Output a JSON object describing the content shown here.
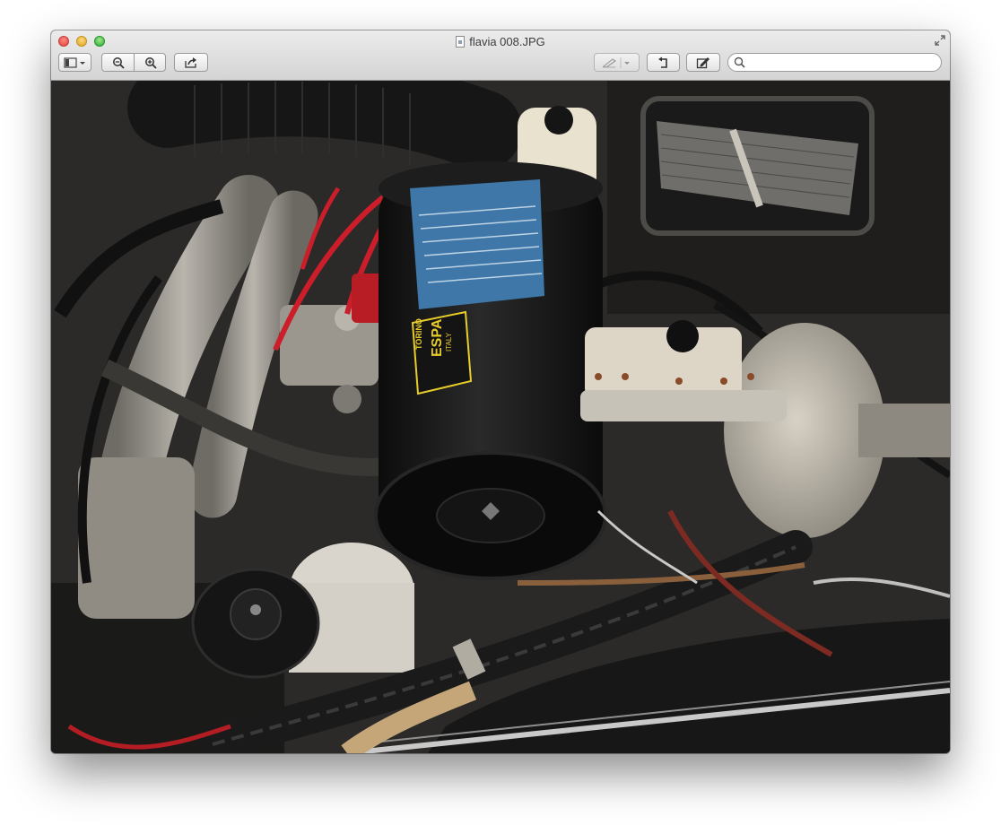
{
  "window": {
    "title": "flavia 008.JPG",
    "icons": [
      "close-button",
      "minimize-button",
      "zoom-button",
      "document-icon",
      "fullscreen-icon"
    ]
  },
  "toolbar": {
    "buttons": [
      {
        "name": "view-mode-button",
        "icon": "sidebar-icon"
      },
      {
        "name": "zoom-out-button",
        "icon": "zoom-out-icon"
      },
      {
        "name": "zoom-in-button",
        "icon": "zoom-in-icon"
      },
      {
        "name": "share-button",
        "icon": "share-icon"
      },
      {
        "name": "markup-pen-button",
        "icon": "pen-icon"
      },
      {
        "name": "rotate-button",
        "icon": "rotate-icon"
      },
      {
        "name": "edit-toolbar-button",
        "icon": "edit-icon"
      }
    ],
    "search": {
      "placeholder": "",
      "value": ""
    }
  },
  "image": {
    "subject": "engine-bay-photo",
    "labels": [
      "TORINO",
      "ESPA",
      "ITALY"
    ]
  }
}
